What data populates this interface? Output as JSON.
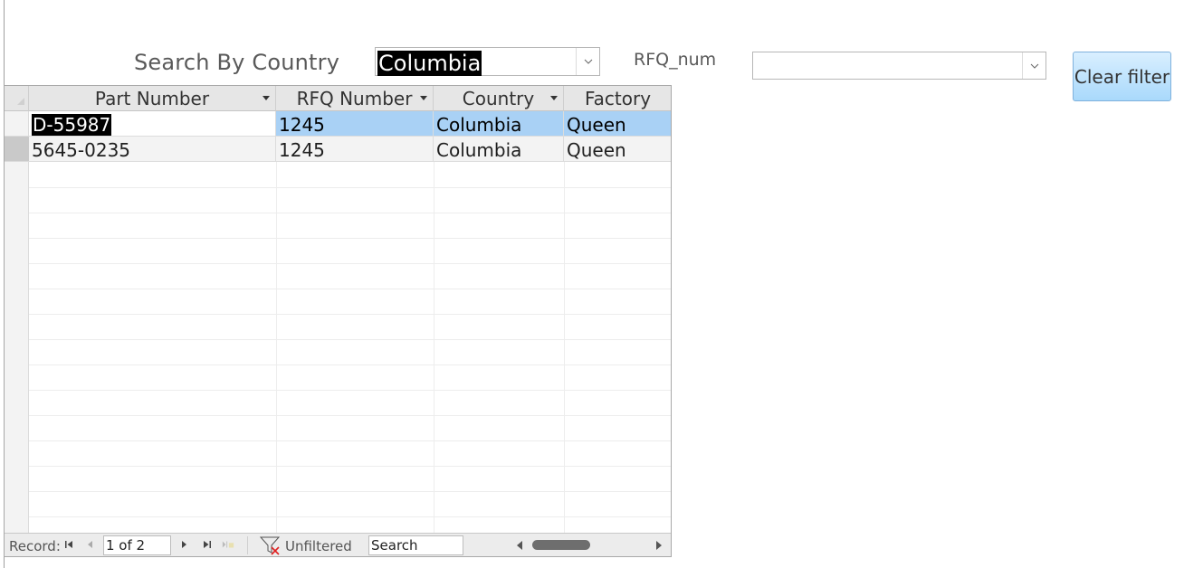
{
  "search": {
    "country_label": "Search By Country",
    "country_value": "Columbia",
    "rfq_label": "RFQ_num",
    "rfq_value": "",
    "clear_label": "Clear filter"
  },
  "table": {
    "columns": [
      "Part Number",
      "RFQ Number",
      "Country",
      "Factory"
    ],
    "rows": [
      [
        "D-55987",
        "1245",
        "Columbia",
        "Queen"
      ],
      [
        "5645-0235",
        "1245",
        "Columbia",
        "Queen"
      ]
    ]
  },
  "navigation": {
    "record_label": "Record:",
    "record_position": "1 of 2",
    "filter_status": "Unfiltered",
    "search_placeholder": "Search"
  },
  "colors": {
    "selected_row": "#a9d1f5",
    "clear_button": "#a9d9fb"
  }
}
